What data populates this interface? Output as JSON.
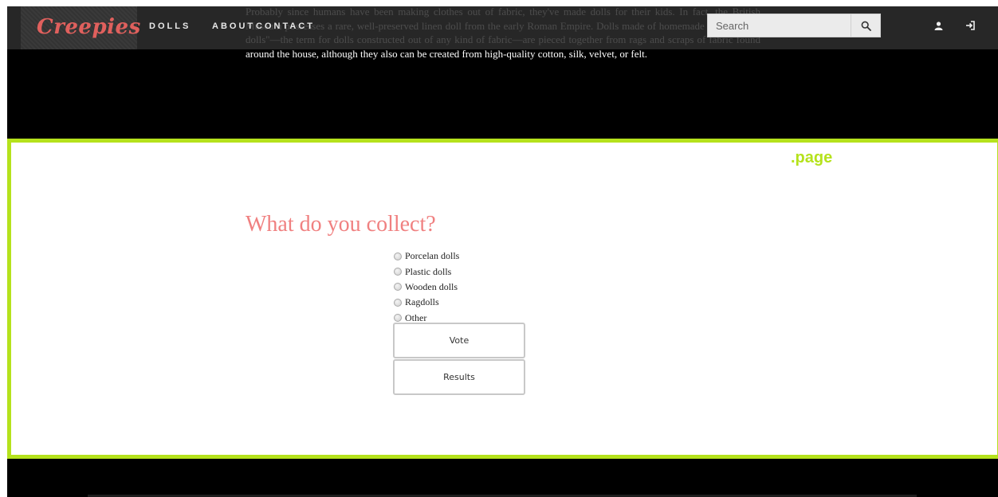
{
  "intro": {
    "text": "Probably since humans have been making clothes out of fabric, they've made dolls for their kids. In fact, the British Museum possesses a rare, well-preserved linen doll from the early Roman Empire. Dolls made of homemade cloth or \"rag dolls\"—the term for dolls constructed out of any kind of fabric—are pieced together from rags and scraps of fabric found around the house, although they also can be created from high-quality cotton, silk, velvet, or felt."
  },
  "navbar": {
    "logo": "Creepies",
    "links": [
      "DOLLS",
      "ABOUT",
      "CONTACT"
    ],
    "search": {
      "placeholder": "Search",
      "value": ""
    },
    "icons": [
      "search-icon",
      "user-icon",
      "sign-in-icon"
    ]
  },
  "page": {
    "label": ".page",
    "poll": {
      "title": "What do you collect?",
      "options": [
        "Porcelan dolls",
        "Plastic dolls",
        "Wooden dolls",
        "Ragdolls",
        "Other"
      ],
      "vote_label": "Vote",
      "results_label": "Results"
    }
  },
  "colors": {
    "accent_green": "#b5e21c",
    "logo_red": "#e0605d",
    "title_pink": "#f08080",
    "backdrop": "#000000",
    "navbar": "#2d2d2d"
  }
}
